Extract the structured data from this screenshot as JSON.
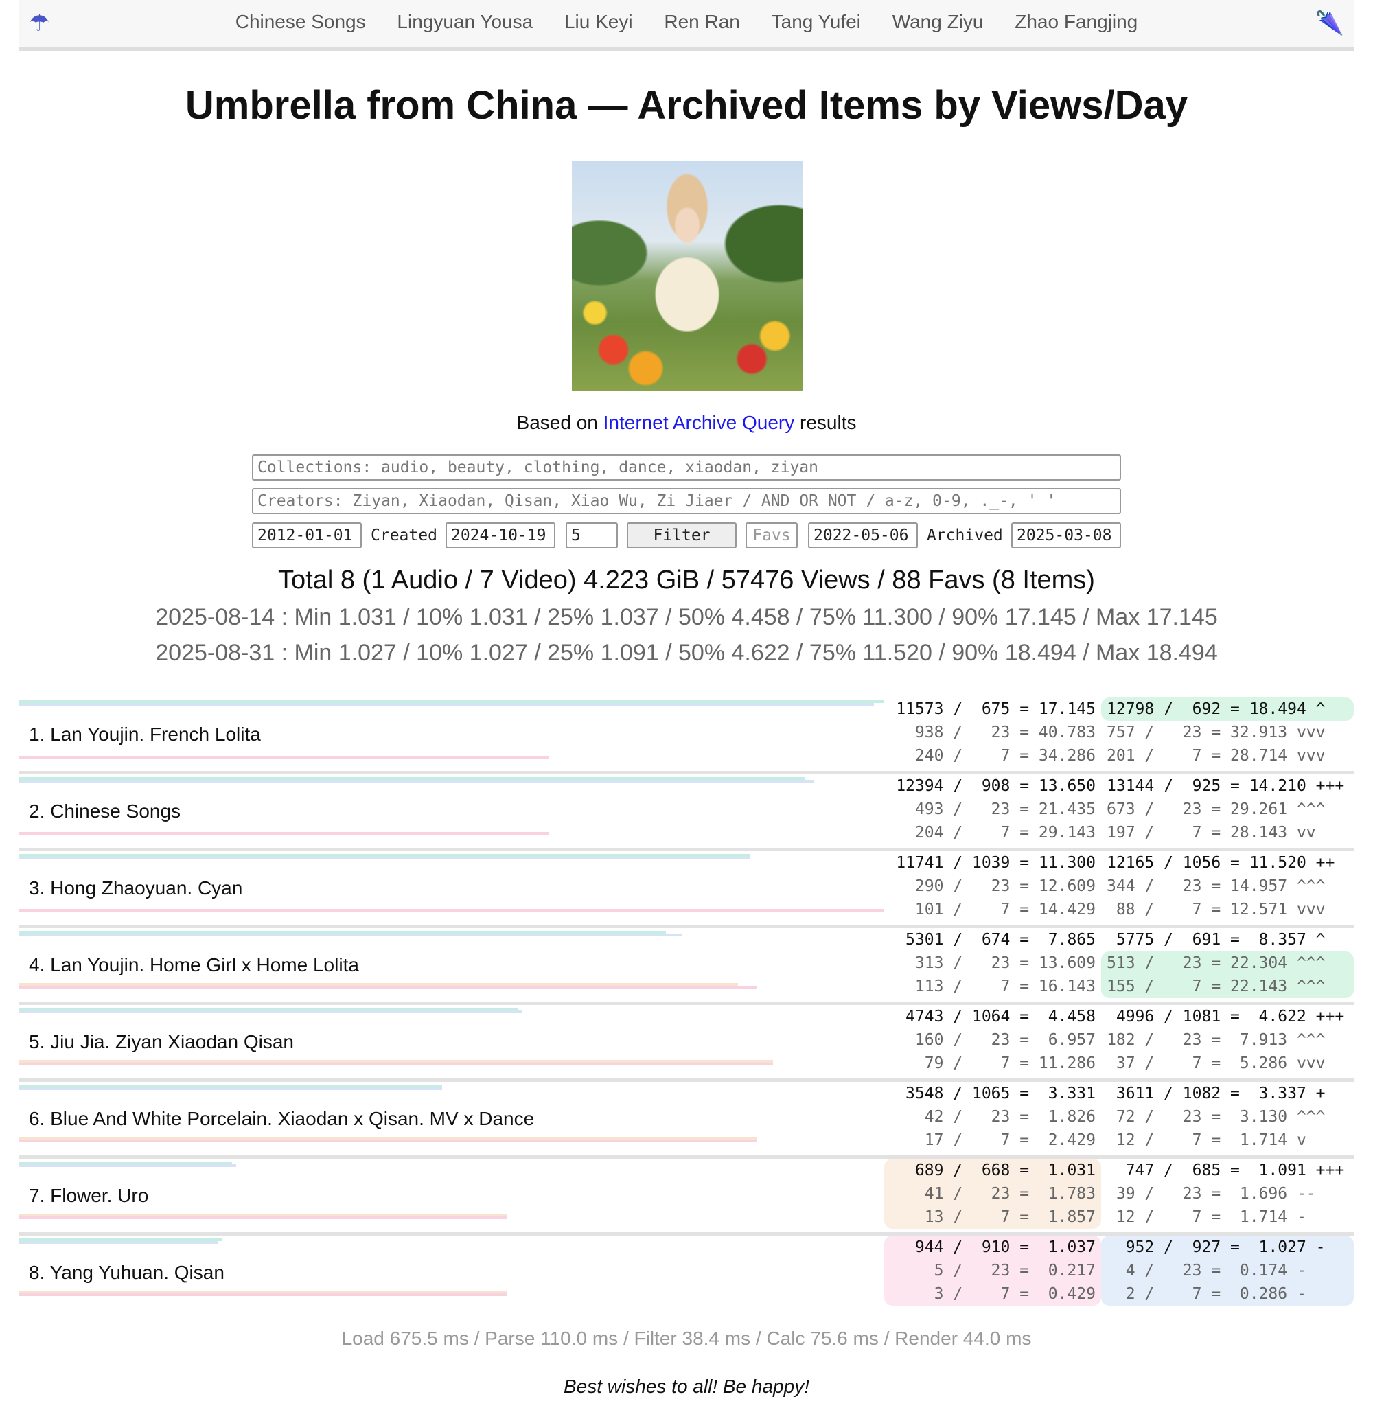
{
  "nav": {
    "left_icon": "☂",
    "right_icon": "🌂",
    "links": [
      "Chinese Songs",
      "Lingyuan Yousa",
      "Liu Keyi",
      "Ren Ran",
      "Tang Yufei",
      "Wang Ziyu",
      "Zhao Fangjing"
    ]
  },
  "page_title": "Umbrella from China — Archived Items by Views/Day",
  "image": {
    "alt": "umbrella-girl-photo"
  },
  "based": {
    "prefix": "Based on",
    "link": "Internet Archive Query",
    "suffix": "results"
  },
  "filters": {
    "collections_placeholder": "Collections: audio, beauty, clothing, dance, xiaodan, ziyan",
    "creators_placeholder": "Creators: Ziyan, Xiaodan, Qisan, Xiao Wu, Zi Jiaer / AND OR NOT / a-z, 0-9, ._-, ' '",
    "created_from": "2012-01-01",
    "created_label": "Created",
    "created_to": "2024-10-19",
    "count": "5",
    "filter_button": "Filter",
    "favs_button": "Favs",
    "archived_from": "2022-05-06",
    "archived_label": "Archived",
    "archived_to": "2025-03-08"
  },
  "summary": {
    "total": "Total 8 (1 Audio / 7 Video) 4.223 GiB / 57476 Views / 88 Favs (8 Items)",
    "stat1": "2025-08-14 : Min 1.031 / 10% 1.031 / 25% 1.037 / 50% 4.458 / 75% 11.300 / 90% 17.145 / Max 17.145",
    "stat2": "2025-08-31 : Min 1.027 / 10% 1.027 / 25% 1.091 / 50% 4.622 / 75% 11.520 / 90% 18.494 / Max 18.494"
  },
  "items": [
    {
      "title": "1. Lan Youjin. French Lolita",
      "c1": [
        "11573 /  675 = 17.145",
        "938 /   23 = 40.783",
        "240 /    7 = 34.286"
      ],
      "c2": [
        "12798 /  692 = 18.494 ^",
        "757 /   23 = 32.913 vvv",
        "201 /    7 = 28.714 vvv"
      ]
    },
    {
      "title": "2. Chinese Songs",
      "c1": [
        "12394 /  908 = 13.650",
        "493 /   23 = 21.435",
        "204 /    7 = 29.143"
      ],
      "c2": [
        "13144 /  925 = 14.210 +++",
        "673 /   23 = 29.261 ^^^",
        "197 /    7 = 28.143 vv"
      ]
    },
    {
      "title": "3. Hong Zhaoyuan. Cyan",
      "c1": [
        "11741 / 1039 = 11.300",
        "290 /   23 = 12.609",
        "101 /    7 = 14.429"
      ],
      "c2": [
        "12165 / 1056 = 11.520 ++",
        "344 /   23 = 14.957 ^^^",
        " 88 /    7 = 12.571 vvv"
      ]
    },
    {
      "title": "4. Lan Youjin. Home Girl x Home Lolita",
      "c1": [
        "5301 /  674 =  7.865",
        "313 /   23 = 13.609",
        "113 /    7 = 16.143"
      ],
      "c2": [
        " 5775 /  691 =  8.357 ^",
        "513 /   23 = 22.304 ^^^",
        "155 /    7 = 22.143 ^^^"
      ]
    },
    {
      "title": "5. Jiu Jia. Ziyan Xiaodan Qisan",
      "c1": [
        "4743 / 1064 =  4.458",
        "160 /   23 =  6.957",
        " 79 /    7 = 11.286"
      ],
      "c2": [
        " 4996 / 1081 =  4.622 +++",
        "182 /   23 =  7.913 ^^^",
        " 37 /    7 =  5.286 vvv"
      ]
    },
    {
      "title": "6. Blue And White Porcelain. Xiaodan x Qisan. MV x Dance",
      "c1": [
        "3548 / 1065 =  3.331",
        " 42 /   23 =  1.826",
        " 17 /    7 =  2.429"
      ],
      "c2": [
        " 3611 / 1082 =  3.337 +",
        " 72 /   23 =  3.130 ^^^",
        " 12 /    7 =  1.714 v"
      ]
    },
    {
      "title": "7. Flower. Uro",
      "c1": [
        "689 /  668 =  1.031",
        " 41 /   23 =  1.783",
        " 13 /    7 =  1.857"
      ],
      "c2": [
        "  747 /  685 =  1.091 +++",
        " 39 /   23 =  1.696 --",
        " 12 /    7 =  1.714 -"
      ]
    },
    {
      "title": "8. Yang Yuhuan. Qisan",
      "c1": [
        "944 /  910 =  1.037",
        "  5 /   23 =  0.217",
        "  3 /    7 =  0.429"
      ],
      "c2": [
        "  952 /  927 =  1.027 -",
        "  4 /   23 =  0.174 -",
        "  2 /    7 =  0.286 -"
      ]
    }
  ],
  "footer": {
    "timing": "Load 675.5 ms / Parse 110.0 ms / Filter 38.4 ms / Calc 75.6 ms / Render 44.0 ms",
    "wish": "Best wishes to all! Be happy!"
  }
}
